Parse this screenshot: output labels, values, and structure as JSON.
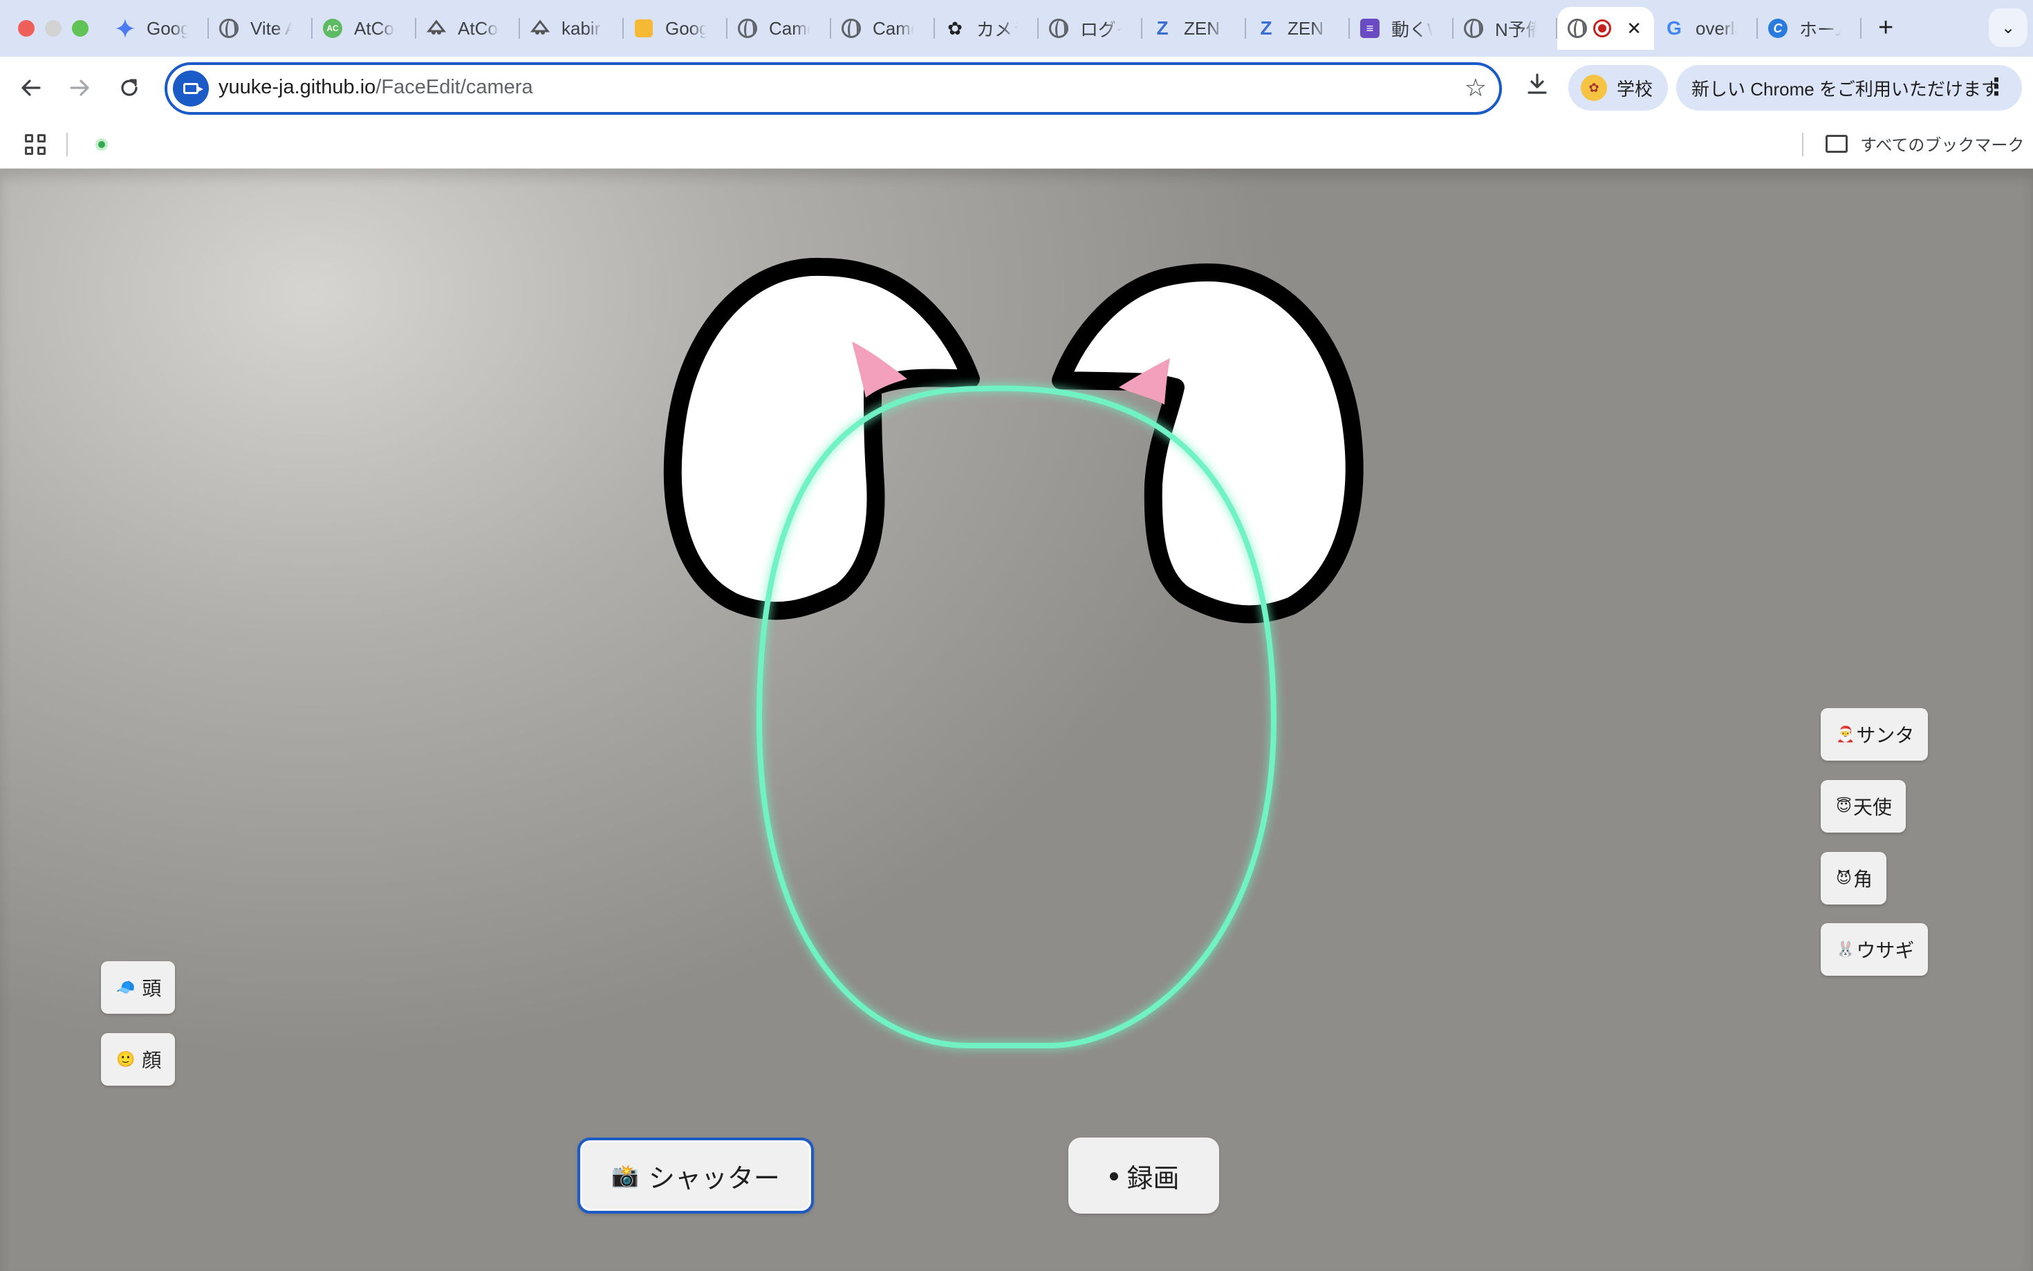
{
  "browser": {
    "tabs": [
      {
        "title": "Google Gemini",
        "icon": "gemini-icon"
      },
      {
        "title": "Vite App",
        "icon": "globe-icon"
      },
      {
        "title": "AtCoder",
        "icon": "atcoder-icon"
      },
      {
        "title": "AtCoder",
        "icon": "atcoder-mascot-icon"
      },
      {
        "title": "kabir",
        "icon": "atcoder-mascot-icon"
      },
      {
        "title": "Google Keep",
        "icon": "keep-icon"
      },
      {
        "title": "Camera",
        "icon": "globe-icon"
      },
      {
        "title": "Camera",
        "icon": "globe-icon"
      },
      {
        "title": "カメラ",
        "icon": "openai-icon"
      },
      {
        "title": "ログイン",
        "icon": "globe-icon"
      },
      {
        "title": "ZEN",
        "icon": "zen-icon"
      },
      {
        "title": "ZEN",
        "icon": "zen-icon"
      },
      {
        "title": "動くW",
        "icon": "list-icon"
      },
      {
        "title": "N予備校",
        "icon": "globe-icon"
      },
      {
        "title": "",
        "icon": "recording-icon",
        "active": true
      },
      {
        "title": "overlay",
        "icon": "google-icon"
      },
      {
        "title": "ホーム",
        "icon": "copilot-icon"
      }
    ],
    "new_tab_label": "+",
    "tab_search_label": "⌄",
    "url_host": "yuuke-ja.github.io",
    "url_path": "/FaceEdit/camera",
    "profile_label": "学校",
    "update_label": "新しい Chrome をご利用いただけます",
    "all_bookmarks_label": "すべてのブックマーク"
  },
  "app": {
    "filters_right": [
      {
        "id": "santa",
        "emoji": "🎅",
        "label": "サンタ"
      },
      {
        "id": "angel",
        "emoji": "😇",
        "label": "天使"
      },
      {
        "id": "horn",
        "emoji": "😈",
        "label": "角"
      },
      {
        "id": "rabbit",
        "emoji": "🐰",
        "label": "ウサギ"
      }
    ],
    "filters_left": [
      {
        "id": "head",
        "emoji": "🧢",
        "label": "頭"
      },
      {
        "id": "face",
        "emoji": "🙂",
        "label": "顔"
      }
    ],
    "shutter": {
      "emoji": "📸",
      "label": "シャッター"
    },
    "record": {
      "emoji": "●",
      "label": "録画"
    }
  },
  "colors": {
    "face_guide": "#6ff2c4",
    "ear_inner": "#f2a0bb",
    "accent": "#1a5bc7"
  }
}
